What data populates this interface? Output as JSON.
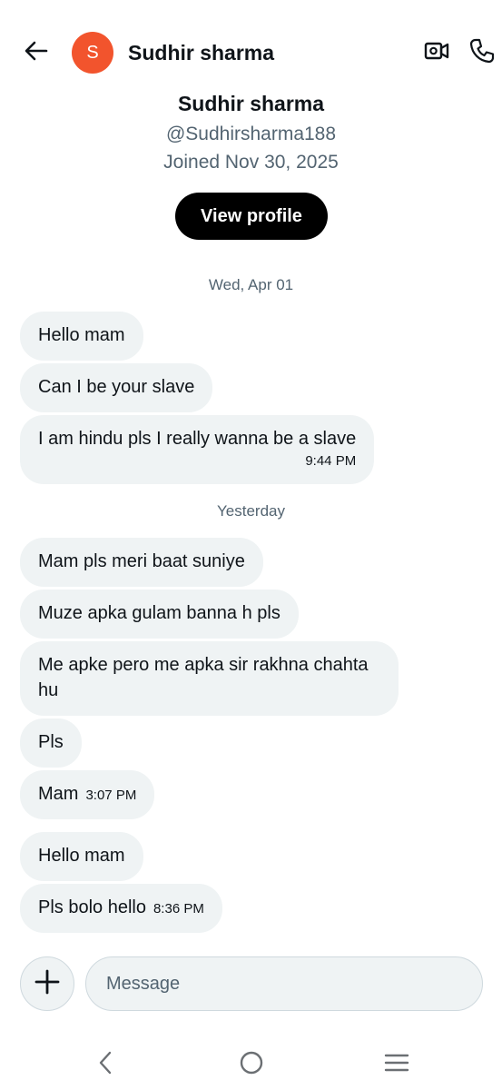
{
  "header": {
    "name": "Sudhir sharma",
    "avatar_letter": "S",
    "avatar_color": "#f2542d",
    "icons": {
      "back": "arrow-left-icon",
      "video": "video-camera-icon",
      "call": "phone-icon"
    }
  },
  "profile": {
    "name": "Sudhir sharma",
    "handle": "@Sudhirsharma188",
    "joined": "Joined Nov 30, 2025",
    "view_profile_label": "View profile"
  },
  "conversation": {
    "groups": [
      {
        "date": "Wed, Apr 01",
        "messages": [
          {
            "text": "Hello mam",
            "time": ""
          },
          {
            "text": "Can I be your slave",
            "time": ""
          },
          {
            "text": "I am hindu pls I really wanna be a slave",
            "time": "9:44 PM"
          }
        ]
      },
      {
        "date": "Yesterday",
        "messages": [
          {
            "text": "Mam pls meri baat suniye",
            "time": ""
          },
          {
            "text": "Muze apka gulam banna h pls",
            "time": ""
          },
          {
            "text": "Me apke pero me apka sir rakhna chahta hu",
            "time": ""
          },
          {
            "text": "Pls",
            "time": ""
          },
          {
            "text": "Mam",
            "time": "3:07 PM"
          },
          {
            "text": "Hello mam",
            "time": ""
          },
          {
            "text": "Pls bolo hello",
            "time": "8:36 PM"
          }
        ]
      }
    ]
  },
  "composer": {
    "placeholder": "Message",
    "add_icon": "plus-icon"
  },
  "system_nav": {
    "icons": [
      "chevron-left-icon",
      "home-circle-icon",
      "menu-icon"
    ]
  },
  "colors": {
    "bubble_bg": "#eff3f4",
    "secondary_text": "#536471",
    "primary_text": "#0f1419",
    "button_bg": "#000000"
  }
}
